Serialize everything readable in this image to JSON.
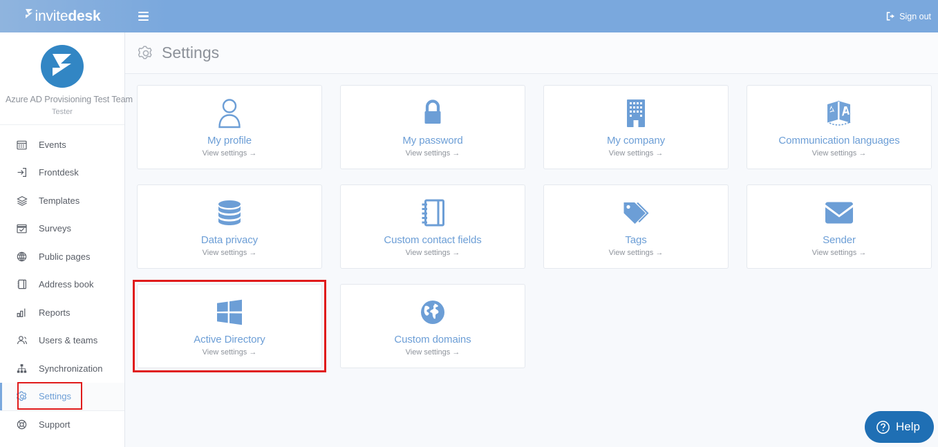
{
  "topbar": {
    "brand_light": "invite",
    "brand_bold": "desk",
    "brand_logo_icon": "invitedesk-logo-icon",
    "menu_icon": "hamburger-menu-icon",
    "signout_label": "Sign out",
    "signout_icon": "sign-out-icon"
  },
  "sidebar": {
    "avatar_icon": "invitedesk-avatar-icon",
    "team_name": "Azure AD Provisioning Test Team",
    "team_role": "Tester",
    "items": [
      {
        "label": "Events",
        "icon": "calendar-icon",
        "active": false
      },
      {
        "label": "Frontdesk",
        "icon": "login-arrow-icon",
        "active": false
      },
      {
        "label": "Templates",
        "icon": "layers-icon",
        "active": false
      },
      {
        "label": "Surveys",
        "icon": "calendar-check-icon",
        "active": false
      },
      {
        "label": "Public pages",
        "icon": "globe-icon",
        "active": false
      },
      {
        "label": "Address book",
        "icon": "address-book-icon",
        "active": false
      },
      {
        "label": "Reports",
        "icon": "bar-chart-icon",
        "active": false
      },
      {
        "label": "Users & teams",
        "icon": "users-icon",
        "active": false
      },
      {
        "label": "Synchronization",
        "icon": "sitemap-icon",
        "active": false
      },
      {
        "label": "Settings",
        "icon": "gear-icon",
        "active": true
      },
      {
        "label": "Support",
        "icon": "lifebuoy-icon",
        "active": false
      }
    ]
  },
  "header": {
    "icon": "gear-icon",
    "title": "Settings"
  },
  "cards": [
    {
      "title": "My profile",
      "sub": "View settings →",
      "icon": "user-icon",
      "selected": false
    },
    {
      "title": "My password",
      "sub": "View settings →",
      "icon": "lock-icon",
      "selected": false
    },
    {
      "title": "My company",
      "sub": "View settings →",
      "icon": "building-icon",
      "selected": false
    },
    {
      "title": "Communication languages",
      "sub": "View settings →",
      "icon": "translate-icon",
      "selected": false
    },
    {
      "title": "Data privacy",
      "sub": "View settings →",
      "icon": "database-icon",
      "selected": false
    },
    {
      "title": "Custom contact fields",
      "sub": "View settings →",
      "icon": "notebook-icon",
      "selected": false
    },
    {
      "title": "Tags",
      "sub": "View settings →",
      "icon": "tags-icon",
      "selected": false
    },
    {
      "title": "Sender",
      "sub": "View settings →",
      "icon": "envelope-icon",
      "selected": false
    },
    {
      "title": "Active Directory",
      "sub": "View settings →",
      "icon": "windows-icon",
      "selected": true
    },
    {
      "title": "Custom domains",
      "sub": "View settings →",
      "icon": "globe-filled-icon",
      "selected": false
    }
  ],
  "help": {
    "label": "Help",
    "icon": "question-circle-icon"
  },
  "colors": {
    "topbar_blue": "#7aa8dd",
    "accent_blue": "#6c9ed6",
    "logo_blue": "#3286c4",
    "help_blue": "#1f6fb4",
    "highlight_red": "#e01b1b",
    "page_bg": "#f7f9fc"
  }
}
